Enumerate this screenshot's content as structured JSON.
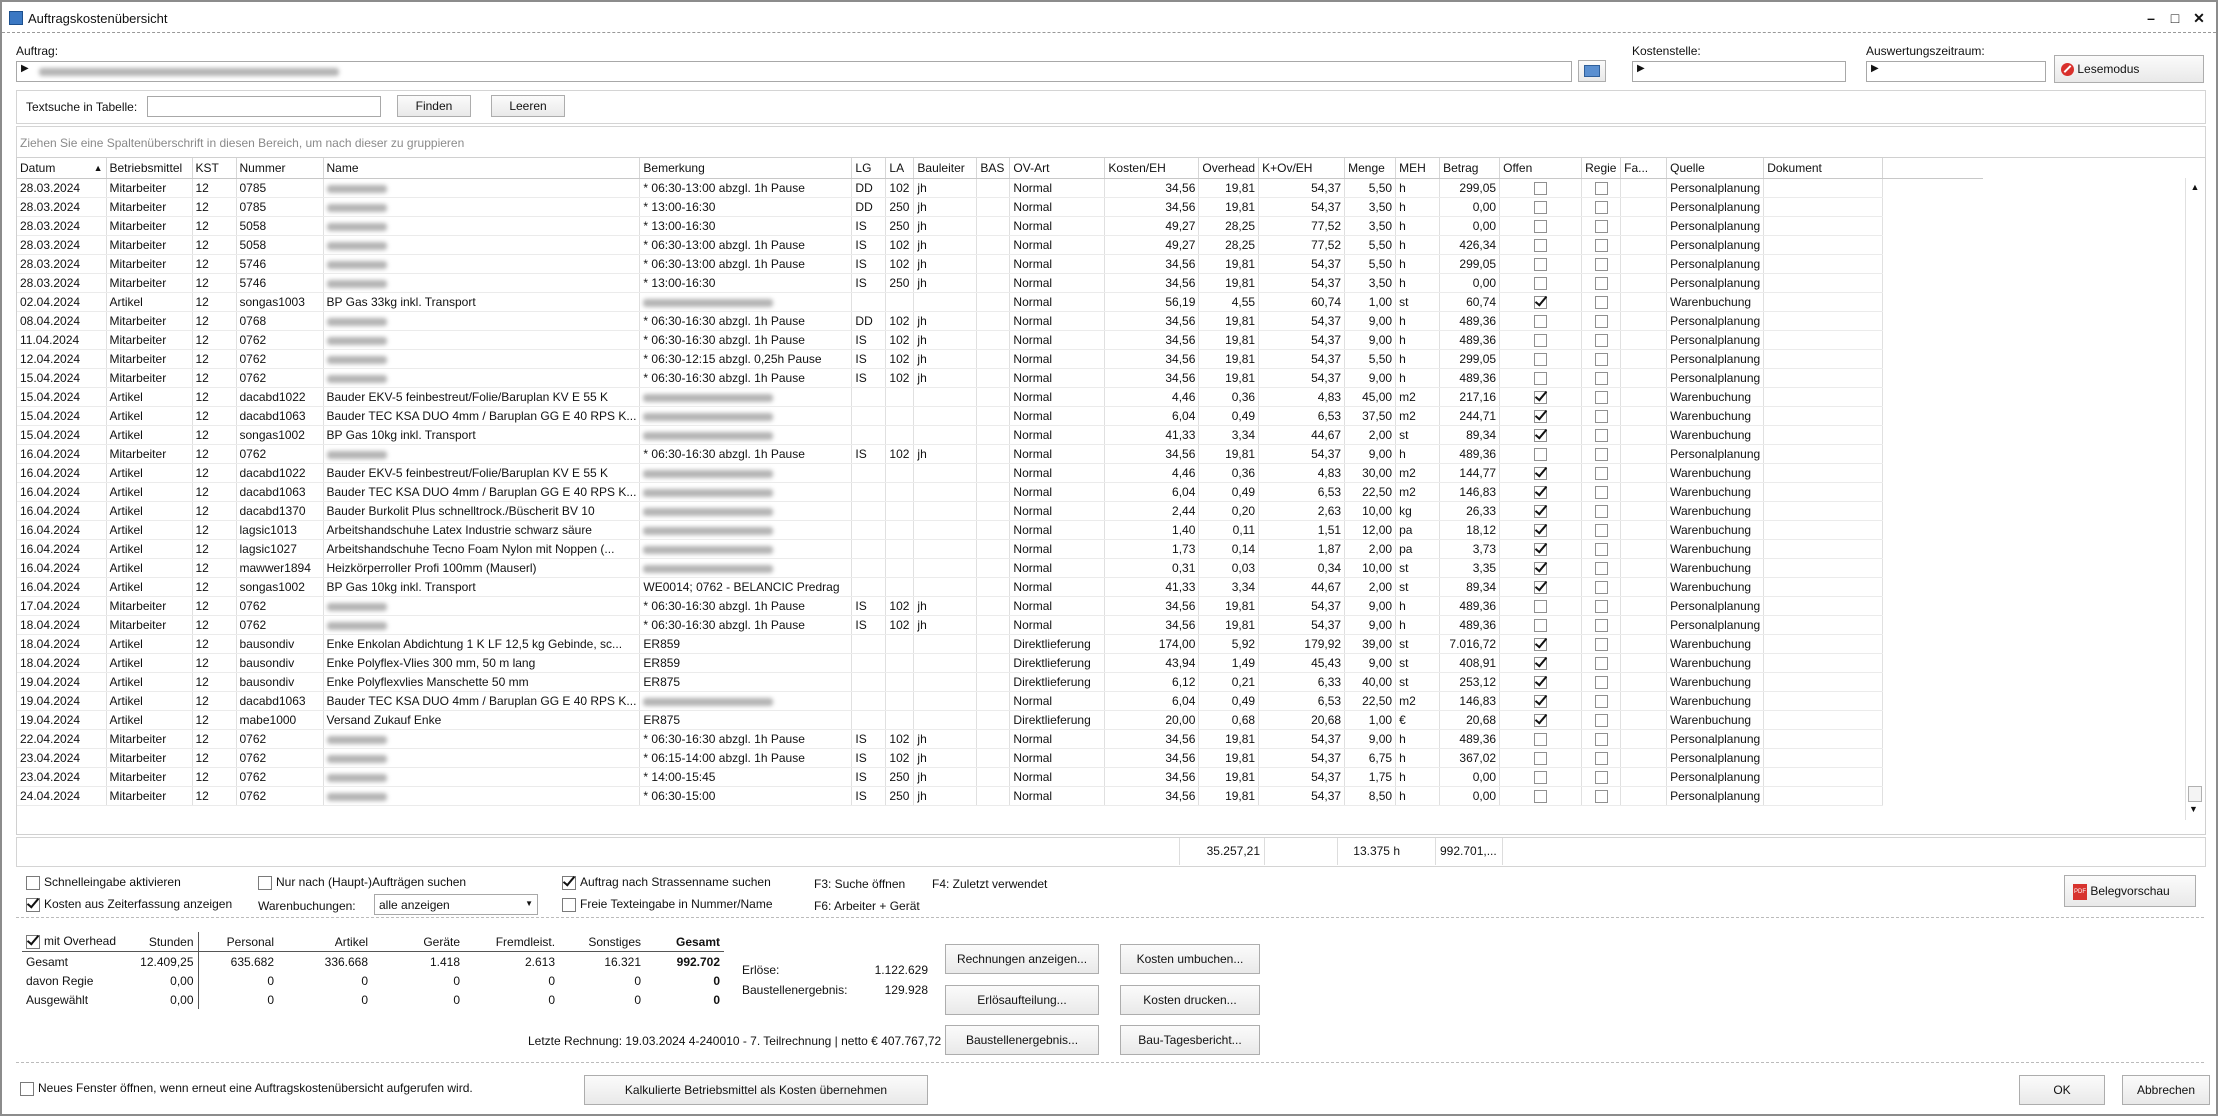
{
  "window": {
    "title": "Auftragskostenübersicht"
  },
  "auftrag": {
    "label": "Auftrag:"
  },
  "kostenstelle": {
    "label": "Kostenstelle:"
  },
  "zeitraum": {
    "label": "Auswertungszeitraum:"
  },
  "lesemodus": {
    "label": "Lesemodus"
  },
  "search": {
    "label": "Textsuche in Tabelle:",
    "find": "Finden",
    "clear": "Leeren"
  },
  "group_hint": "Ziehen Sie eine Spaltenüberschrift in diesen Bereich, um nach dieser zu gruppieren",
  "columns": [
    "Datum",
    "Betriebsmittel",
    "KST",
    "Nummer",
    "Name",
    "Bemerkung",
    "LG",
    "LA",
    "Bauleiter",
    "BAS",
    "OV-Art",
    "Kosten/EH",
    "Overhead",
    "K+Ov/EH",
    "Menge",
    "MEH",
    "Betrag",
    "Offen",
    "Regie",
    "Fa...",
    "Quelle",
    "Dokument"
  ],
  "rows": [
    {
      "datum": "28.03.2024",
      "bm": "Mitarbeiter",
      "kst": "12",
      "nr": "0785",
      "name": "",
      "bem": "* 06:30-13:00 abzgl. 1h Pause",
      "lg": "DD",
      "la": "102",
      "bl": "jh",
      "ov": "Normal",
      "k": "34,56",
      "o": "19,81",
      "ko": "54,37",
      "m": "5,50",
      "meh": "h",
      "b": "299,05",
      "offen": false,
      "q": "Personalplanung"
    },
    {
      "datum": "28.03.2024",
      "bm": "Mitarbeiter",
      "kst": "12",
      "nr": "0785",
      "name": "",
      "bem": "* 13:00-16:30",
      "lg": "DD",
      "la": "250",
      "bl": "jh",
      "ov": "Normal",
      "k": "34,56",
      "o": "19,81",
      "ko": "54,37",
      "m": "3,50",
      "meh": "h",
      "b": "0,00",
      "offen": false,
      "q": "Personalplanung"
    },
    {
      "datum": "28.03.2024",
      "bm": "Mitarbeiter",
      "kst": "12",
      "nr": "5058",
      "name": "",
      "bem": "* 13:00-16:30",
      "lg": "IS",
      "la": "250",
      "bl": "jh",
      "ov": "Normal",
      "k": "49,27",
      "o": "28,25",
      "ko": "77,52",
      "m": "3,50",
      "meh": "h",
      "b": "0,00",
      "offen": false,
      "q": "Personalplanung"
    },
    {
      "datum": "28.03.2024",
      "bm": "Mitarbeiter",
      "kst": "12",
      "nr": "5058",
      "name": "",
      "bem": "* 06:30-13:00 abzgl. 1h Pause",
      "lg": "IS",
      "la": "102",
      "bl": "jh",
      "ov": "Normal",
      "k": "49,27",
      "o": "28,25",
      "ko": "77,52",
      "m": "5,50",
      "meh": "h",
      "b": "426,34",
      "offen": false,
      "q": "Personalplanung"
    },
    {
      "datum": "28.03.2024",
      "bm": "Mitarbeiter",
      "kst": "12",
      "nr": "5746",
      "name": "",
      "bem": "* 06:30-13:00 abzgl. 1h Pause",
      "lg": "IS",
      "la": "102",
      "bl": "jh",
      "ov": "Normal",
      "k": "34,56",
      "o": "19,81",
      "ko": "54,37",
      "m": "5,50",
      "meh": "h",
      "b": "299,05",
      "offen": false,
      "q": "Personalplanung"
    },
    {
      "datum": "28.03.2024",
      "bm": "Mitarbeiter",
      "kst": "12",
      "nr": "5746",
      "name": "",
      "bem": "* 13:00-16:30",
      "lg": "IS",
      "la": "250",
      "bl": "jh",
      "ov": "Normal",
      "k": "34,56",
      "o": "19,81",
      "ko": "54,37",
      "m": "3,50",
      "meh": "h",
      "b": "0,00",
      "offen": false,
      "q": "Personalplanung"
    },
    {
      "datum": "02.04.2024",
      "bm": "Artikel",
      "kst": "12",
      "nr": "songas1003",
      "name": "BP Gas 33kg inkl. Transport",
      "bem": "",
      "lg": "",
      "la": "",
      "bl": "",
      "ov": "Normal",
      "k": "56,19",
      "o": "4,55",
      "ko": "60,74",
      "m": "1,00",
      "meh": "st",
      "b": "60,74",
      "offen": true,
      "q": "Warenbuchung"
    },
    {
      "datum": "08.04.2024",
      "bm": "Mitarbeiter",
      "kst": "12",
      "nr": "0768",
      "name": "",
      "bem": "* 06:30-16:30 abzgl. 1h Pause",
      "lg": "DD",
      "la": "102",
      "bl": "jh",
      "ov": "Normal",
      "k": "34,56",
      "o": "19,81",
      "ko": "54,37",
      "m": "9,00",
      "meh": "h",
      "b": "489,36",
      "offen": false,
      "q": "Personalplanung"
    },
    {
      "datum": "11.04.2024",
      "bm": "Mitarbeiter",
      "kst": "12",
      "nr": "0762",
      "name": "",
      "bem": "* 06:30-16:30 abzgl. 1h Pause",
      "lg": "IS",
      "la": "102",
      "bl": "jh",
      "ov": "Normal",
      "k": "34,56",
      "o": "19,81",
      "ko": "54,37",
      "m": "9,00",
      "meh": "h",
      "b": "489,36",
      "offen": false,
      "q": "Personalplanung"
    },
    {
      "datum": "12.04.2024",
      "bm": "Mitarbeiter",
      "kst": "12",
      "nr": "0762",
      "name": "",
      "bem": "* 06:30-12:15 abzgl. 0,25h Pause",
      "lg": "IS",
      "la": "102",
      "bl": "jh",
      "ov": "Normal",
      "k": "34,56",
      "o": "19,81",
      "ko": "54,37",
      "m": "5,50",
      "meh": "h",
      "b": "299,05",
      "offen": false,
      "q": "Personalplanung"
    },
    {
      "datum": "15.04.2024",
      "bm": "Mitarbeiter",
      "kst": "12",
      "nr": "0762",
      "name": "",
      "bem": "* 06:30-16:30 abzgl. 1h Pause",
      "lg": "IS",
      "la": "102",
      "bl": "jh",
      "ov": "Normal",
      "k": "34,56",
      "o": "19,81",
      "ko": "54,37",
      "m": "9,00",
      "meh": "h",
      "b": "489,36",
      "offen": false,
      "q": "Personalplanung"
    },
    {
      "datum": "15.04.2024",
      "bm": "Artikel",
      "kst": "12",
      "nr": "dacabd1022",
      "name": "Bauder EKV-5 feinbestreut/Folie/Baruplan KV E 55 K",
      "bem": "",
      "lg": "",
      "la": "",
      "bl": "",
      "ov": "Normal",
      "k": "4,46",
      "o": "0,36",
      "ko": "4,83",
      "m": "45,00",
      "meh": "m2",
      "b": "217,16",
      "offen": true,
      "q": "Warenbuchung"
    },
    {
      "datum": "15.04.2024",
      "bm": "Artikel",
      "kst": "12",
      "nr": "dacabd1063",
      "name": "Bauder TEC KSA DUO 4mm / Baruplan GG E 40 RPS K...",
      "bem": "",
      "lg": "",
      "la": "",
      "bl": "",
      "ov": "Normal",
      "k": "6,04",
      "o": "0,49",
      "ko": "6,53",
      "m": "37,50",
      "meh": "m2",
      "b": "244,71",
      "offen": true,
      "q": "Warenbuchung"
    },
    {
      "datum": "15.04.2024",
      "bm": "Artikel",
      "kst": "12",
      "nr": "songas1002",
      "name": "BP Gas 10kg inkl. Transport",
      "bem": "",
      "lg": "",
      "la": "",
      "bl": "",
      "ov": "Normal",
      "k": "41,33",
      "o": "3,34",
      "ko": "44,67",
      "m": "2,00",
      "meh": "st",
      "b": "89,34",
      "offen": true,
      "q": "Warenbuchung"
    },
    {
      "datum": "16.04.2024",
      "bm": "Mitarbeiter",
      "kst": "12",
      "nr": "0762",
      "name": "",
      "bem": "* 06:30-16:30 abzgl. 1h Pause",
      "lg": "IS",
      "la": "102",
      "bl": "jh",
      "ov": "Normal",
      "k": "34,56",
      "o": "19,81",
      "ko": "54,37",
      "m": "9,00",
      "meh": "h",
      "b": "489,36",
      "offen": false,
      "q": "Personalplanung"
    },
    {
      "datum": "16.04.2024",
      "bm": "Artikel",
      "kst": "12",
      "nr": "dacabd1022",
      "name": "Bauder EKV-5 feinbestreut/Folie/Baruplan KV E 55 K",
      "bem": "",
      "lg": "",
      "la": "",
      "bl": "",
      "ov": "Normal",
      "k": "4,46",
      "o": "0,36",
      "ko": "4,83",
      "m": "30,00",
      "meh": "m2",
      "b": "144,77",
      "offen": true,
      "q": "Warenbuchung"
    },
    {
      "datum": "16.04.2024",
      "bm": "Artikel",
      "kst": "12",
      "nr": "dacabd1063",
      "name": "Bauder TEC KSA DUO 4mm / Baruplan GG E 40 RPS K...",
      "bem": "",
      "lg": "",
      "la": "",
      "bl": "",
      "ov": "Normal",
      "k": "6,04",
      "o": "0,49",
      "ko": "6,53",
      "m": "22,50",
      "meh": "m2",
      "b": "146,83",
      "offen": true,
      "q": "Warenbuchung"
    },
    {
      "datum": "16.04.2024",
      "bm": "Artikel",
      "kst": "12",
      "nr": "dacabd1370",
      "name": "Bauder Burkolit Plus schnelltrock./Büscherit BV 10",
      "bem": "",
      "lg": "",
      "la": "",
      "bl": "",
      "ov": "Normal",
      "k": "2,44",
      "o": "0,20",
      "ko": "2,63",
      "m": "10,00",
      "meh": "kg",
      "b": "26,33",
      "offen": true,
      "q": "Warenbuchung"
    },
    {
      "datum": "16.04.2024",
      "bm": "Artikel",
      "kst": "12",
      "nr": "lagsic1013",
      "name": "Arbeitshandschuhe Latex Industrie schwarz säure",
      "bem": "",
      "lg": "",
      "la": "",
      "bl": "",
      "ov": "Normal",
      "k": "1,40",
      "o": "0,11",
      "ko": "1,51",
      "m": "12,00",
      "meh": "pa",
      "b": "18,12",
      "offen": true,
      "q": "Warenbuchung"
    },
    {
      "datum": "16.04.2024",
      "bm": "Artikel",
      "kst": "12",
      "nr": "lagsic1027",
      "name": "Arbeitshandschuhe Tecno Foam Nylon mit Noppen (...",
      "bem": "",
      "lg": "",
      "la": "",
      "bl": "",
      "ov": "Normal",
      "k": "1,73",
      "o": "0,14",
      "ko": "1,87",
      "m": "2,00",
      "meh": "pa",
      "b": "3,73",
      "offen": true,
      "q": "Warenbuchung"
    },
    {
      "datum": "16.04.2024",
      "bm": "Artikel",
      "kst": "12",
      "nr": "mawwer1894",
      "name": "Heizkörperroller Profi 100mm (Mauserl)",
      "bem": "",
      "lg": "",
      "la": "",
      "bl": "",
      "ov": "Normal",
      "k": "0,31",
      "o": "0,03",
      "ko": "0,34",
      "m": "10,00",
      "meh": "st",
      "b": "3,35",
      "offen": true,
      "q": "Warenbuchung"
    },
    {
      "datum": "16.04.2024",
      "bm": "Artikel",
      "kst": "12",
      "nr": "songas1002",
      "name": "BP Gas 10kg inkl. Transport",
      "bem": "WE0014; 0762 - BELANCIC  Predrag",
      "lg": "",
      "la": "",
      "bl": "",
      "ov": "Normal",
      "k": "41,33",
      "o": "3,34",
      "ko": "44,67",
      "m": "2,00",
      "meh": "st",
      "b": "89,34",
      "offen": true,
      "q": "Warenbuchung"
    },
    {
      "datum": "17.04.2024",
      "bm": "Mitarbeiter",
      "kst": "12",
      "nr": "0762",
      "name": "",
      "bem": "* 06:30-16:30 abzgl. 1h Pause",
      "lg": "IS",
      "la": "102",
      "bl": "jh",
      "ov": "Normal",
      "k": "34,56",
      "o": "19,81",
      "ko": "54,37",
      "m": "9,00",
      "meh": "h",
      "b": "489,36",
      "offen": false,
      "q": "Personalplanung"
    },
    {
      "datum": "18.04.2024",
      "bm": "Mitarbeiter",
      "kst": "12",
      "nr": "0762",
      "name": "",
      "bem": "* 06:30-16:30 abzgl. 1h Pause",
      "lg": "IS",
      "la": "102",
      "bl": "jh",
      "ov": "Normal",
      "k": "34,56",
      "o": "19,81",
      "ko": "54,37",
      "m": "9,00",
      "meh": "h",
      "b": "489,36",
      "offen": false,
      "q": "Personalplanung"
    },
    {
      "datum": "18.04.2024",
      "bm": "Artikel",
      "kst": "12",
      "nr": "bausondiv",
      "name": "Enke Enkolan Abdichtung 1 K LF 12,5 kg Gebinde, sc...",
      "bem": "ER859",
      "lg": "",
      "la": "",
      "bl": "",
      "ov": "Direktlieferung",
      "k": "174,00",
      "o": "5,92",
      "ko": "179,92",
      "m": "39,00",
      "meh": "st",
      "b": "7.016,72",
      "offen": true,
      "q": "Warenbuchung"
    },
    {
      "datum": "18.04.2024",
      "bm": "Artikel",
      "kst": "12",
      "nr": "bausondiv",
      "name": "Enke Polyflex-Vlies 300 mm, 50 m lang",
      "bem": "ER859",
      "lg": "",
      "la": "",
      "bl": "",
      "ov": "Direktlieferung",
      "k": "43,94",
      "o": "1,49",
      "ko": "45,43",
      "m": "9,00",
      "meh": "st",
      "b": "408,91",
      "offen": true,
      "q": "Warenbuchung"
    },
    {
      "datum": "19.04.2024",
      "bm": "Artikel",
      "kst": "12",
      "nr": "bausondiv",
      "name": "Enke Polyflexvlies Manschette 50 mm",
      "bem": "ER875",
      "lg": "",
      "la": "",
      "bl": "",
      "ov": "Direktlieferung",
      "k": "6,12",
      "o": "0,21",
      "ko": "6,33",
      "m": "40,00",
      "meh": "st",
      "b": "253,12",
      "offen": true,
      "q": "Warenbuchung"
    },
    {
      "datum": "19.04.2024",
      "bm": "Artikel",
      "kst": "12",
      "nr": "dacabd1063",
      "name": "Bauder TEC KSA DUO 4mm / Baruplan GG E 40 RPS K...",
      "bem": "",
      "lg": "",
      "la": "",
      "bl": "",
      "ov": "Normal",
      "k": "6,04",
      "o": "0,49",
      "ko": "6,53",
      "m": "22,50",
      "meh": "m2",
      "b": "146,83",
      "offen": true,
      "q": "Warenbuchung"
    },
    {
      "datum": "19.04.2024",
      "bm": "Artikel",
      "kst": "12",
      "nr": "mabe1000",
      "name": "Versand Zukauf Enke",
      "bem": "ER875",
      "lg": "",
      "la": "",
      "bl": "",
      "ov": "Direktlieferung",
      "k": "20,00",
      "o": "0,68",
      "ko": "20,68",
      "m": "1,00",
      "meh": "€",
      "b": "20,68",
      "offen": true,
      "q": "Warenbuchung"
    },
    {
      "datum": "22.04.2024",
      "bm": "Mitarbeiter",
      "kst": "12",
      "nr": "0762",
      "name": "",
      "bem": "* 06:30-16:30 abzgl. 1h Pause",
      "lg": "IS",
      "la": "102",
      "bl": "jh",
      "ov": "Normal",
      "k": "34,56",
      "o": "19,81",
      "ko": "54,37",
      "m": "9,00",
      "meh": "h",
      "b": "489,36",
      "offen": false,
      "q": "Personalplanung"
    },
    {
      "datum": "23.04.2024",
      "bm": "Mitarbeiter",
      "kst": "12",
      "nr": "0762",
      "name": "",
      "bem": "* 06:15-14:00 abzgl. 1h Pause",
      "lg": "IS",
      "la": "102",
      "bl": "jh",
      "ov": "Normal",
      "k": "34,56",
      "o": "19,81",
      "ko": "54,37",
      "m": "6,75",
      "meh": "h",
      "b": "367,02",
      "offen": false,
      "q": "Personalplanung"
    },
    {
      "datum": "23.04.2024",
      "bm": "Mitarbeiter",
      "kst": "12",
      "nr": "0762",
      "name": "",
      "bem": "* 14:00-15:45",
      "lg": "IS",
      "la": "250",
      "bl": "jh",
      "ov": "Normal",
      "k": "34,56",
      "o": "19,81",
      "ko": "54,37",
      "m": "1,75",
      "meh": "h",
      "b": "0,00",
      "offen": false,
      "q": "Personalplanung"
    },
    {
      "datum": "24.04.2024",
      "bm": "Mitarbeiter",
      "kst": "12",
      "nr": "0762",
      "name": "",
      "bem": "* 06:30-15:00",
      "lg": "IS",
      "la": "250",
      "bl": "jh",
      "ov": "Normal",
      "k": "34,56",
      "o": "19,81",
      "ko": "54,37",
      "m": "8,50",
      "meh": "h",
      "b": "0,00",
      "offen": false,
      "q": "Personalplanung"
    }
  ],
  "totals": {
    "overhead": "35.257,21",
    "menge": "13.375 h",
    "betrag": "992.701,..."
  },
  "options": {
    "schnelleingabe": "Schnelleingabe aktivieren",
    "zeiterfassung": "Kosten aus Zeiterfassung anzeigen",
    "hauptauftraege": "Nur nach (Haupt-)Aufträgen suchen",
    "warenbuchungen_label": "Warenbuchungen:",
    "warenbuchungen_value": "alle anzeigen",
    "strassenname": "Auftrag nach Strassenname suchen",
    "freie_texteingabe": "Freie Texteingabe in Nummer/Name",
    "f3": "F3: Suche öffnen",
    "f4": "F4: Zuletzt verwendet",
    "f6": "F6: Arbeiter + Gerät",
    "belegvorschau": "Belegvorschau"
  },
  "summary": {
    "mit_overhead": "mit Overhead",
    "headers": [
      "Stunden",
      "Personal",
      "Artikel",
      "Geräte",
      "Fremdleist.",
      "Sonstiges",
      "Gesamt"
    ],
    "rows": [
      {
        "label": "Gesamt",
        "values": [
          "12.409,25",
          "635.682",
          "336.668",
          "1.418",
          "2.613",
          "16.321",
          "992.702"
        ]
      },
      {
        "label": "davon Regie",
        "values": [
          "0,00",
          "0",
          "0",
          "0",
          "0",
          "0",
          "0"
        ]
      },
      {
        "label": "Ausgewählt",
        "values": [
          "0,00",
          "0",
          "0",
          "0",
          "0",
          "0",
          "0"
        ]
      }
    ],
    "erloese_label": "Erlöse:",
    "erloese": "1.122.629",
    "ergebnis_label": "Baustellenergebnis:",
    "ergebnis": "129.928",
    "letzte_rechnung": "Letzte Rechnung: 19.03.2024   4-240010 - 7. Teilrechnung | netto € 407.767,72"
  },
  "actions": {
    "rechnungen": "Rechnungen anzeigen...",
    "erloesaufteilung": "Erlösaufteilung...",
    "baustellenergebnis": "Baustellenergebnis...",
    "umbuchen": "Kosten umbuchen...",
    "drucken": "Kosten drucken...",
    "tagesbericht": "Bau-Tagesbericht..."
  },
  "footer": {
    "neues_fenster": "Neues Fenster öffnen, wenn erneut eine Auftragskostenübersicht aufgerufen wird.",
    "kalkulierte": "Kalkulierte Betriebsmittel als Kosten übernehmen",
    "ok": "OK",
    "abbrechen": "Abbrechen"
  }
}
